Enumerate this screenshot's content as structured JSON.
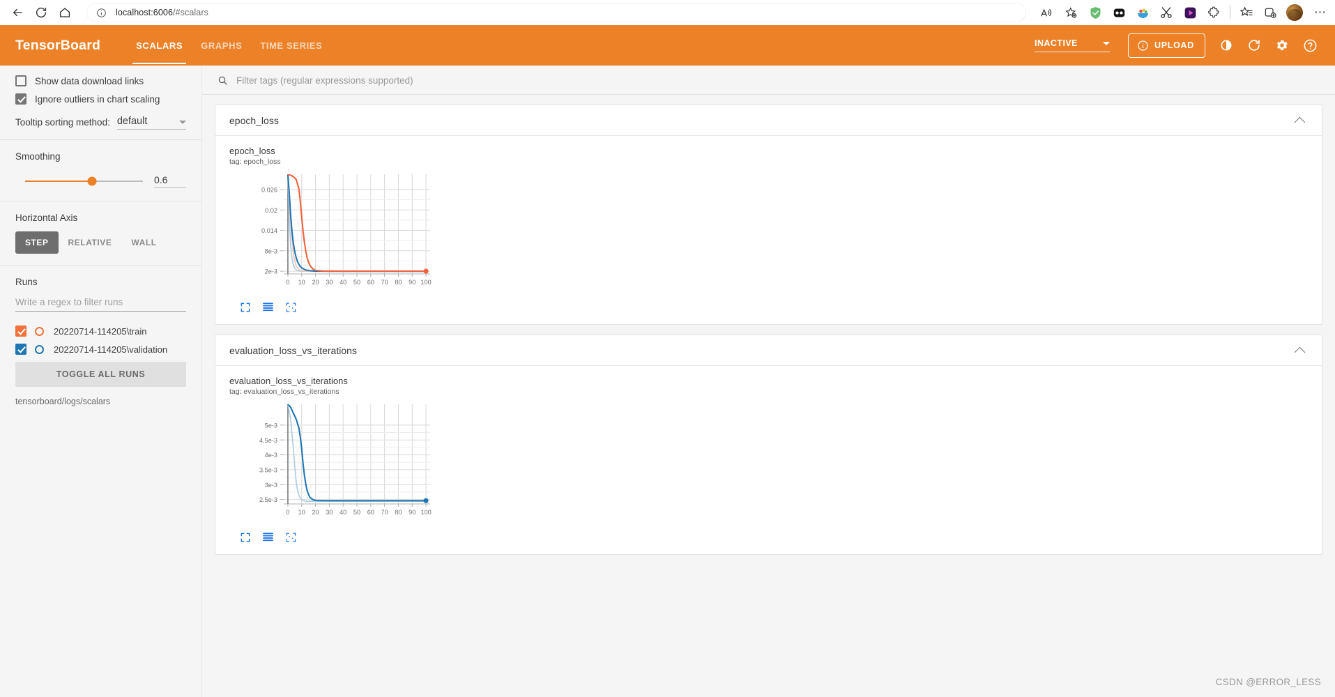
{
  "browser": {
    "back_icon": "arrow-left-icon",
    "reload_icon": "reload-icon",
    "home_icon": "home-icon",
    "url_info_icon": "info-circle-icon",
    "url_host": "localhost:6006",
    "url_path": "/#scalars",
    "read_aloud_icon": "read-aloud-icon",
    "add_favorite_icon": "favorite-star-add-icon",
    "extensions": [
      {
        "name": "adguard-shield-icon",
        "color": "#6ac46a"
      },
      {
        "name": "dark-reader-icon",
        "color": "#141414"
      },
      {
        "name": "bowl-icon",
        "color": "#3a9fd6"
      },
      {
        "name": "scissors-icon",
        "color": "#2b2b2b"
      },
      {
        "name": "media-player-icon",
        "color": "#3b1c58"
      },
      {
        "name": "puzzle-extension-icon",
        "color": "#5a5a5a"
      }
    ],
    "collections_icon": "favorites-list-icon",
    "split-screen_icon": "add-tab-group-icon",
    "avatar": "user-avatar",
    "more_icon": "more-horizontal-icon"
  },
  "header": {
    "logo": "TensorBoard",
    "tabs": [
      {
        "label": "SCALARS",
        "active": true
      },
      {
        "label": "GRAPHS",
        "active": false
      },
      {
        "label": "TIME SERIES",
        "active": false
      }
    ],
    "reload_status": "INACTIVE",
    "upload_label": "UPLOAD",
    "upload_icon": "info-circle-icon",
    "brightness_icon": "brightness-contrast-icon",
    "refresh_icon": "refresh-icon",
    "settings_icon": "gear-icon",
    "help_icon": "help-circle-icon",
    "accent_color": "#ec8127"
  },
  "sidebar": {
    "show_download_links": {
      "label": "Show data download links",
      "checked": false
    },
    "ignore_outliers": {
      "label": "Ignore outliers in chart scaling",
      "checked": true
    },
    "tooltip_sorting": {
      "label": "Tooltip sorting method:",
      "value": "default"
    },
    "smoothing": {
      "label": "Smoothing",
      "value": "0.6",
      "fraction": 0.6
    },
    "horizontal_axis": {
      "label": "Horizontal Axis",
      "options": [
        "STEP",
        "RELATIVE",
        "WALL"
      ],
      "selected": "STEP"
    },
    "runs": {
      "label": "Runs",
      "filter_placeholder": "Write a regex to filter runs",
      "items": [
        {
          "name": "20220714-114205\\train",
          "color": "#f2713a",
          "checked": true
        },
        {
          "name": "20220714-114205\\validation",
          "color": "#1f77b4",
          "checked": true
        }
      ],
      "toggle_all_label": "TOGGLE ALL RUNS",
      "logdir": "tensorboard/logs/scalars"
    }
  },
  "main": {
    "search": {
      "placeholder": "Filter tags (regular expressions supported)",
      "value": "",
      "icon": "search-icon"
    },
    "cards": [
      {
        "title": "epoch_loss",
        "collapse_icon": "chevron-up-icon",
        "chart": {
          "title": "epoch_loss",
          "tag": "tag: epoch_loss"
        },
        "tools": [
          {
            "name": "expand-chart-icon"
          },
          {
            "name": "data-table-icon"
          },
          {
            "name": "fit-domain-icon"
          }
        ]
      },
      {
        "title": "evaluation_loss_vs_iterations",
        "collapse_icon": "chevron-up-icon",
        "chart": {
          "title": "evaluation_loss_vs_iterations",
          "tag": "tag: evaluation_loss_vs_iterations"
        },
        "tools": [
          {
            "name": "expand-chart-icon"
          },
          {
            "name": "data-table-icon"
          },
          {
            "name": "fit-domain-icon"
          }
        ]
      }
    ]
  },
  "watermark": "CSDN @ERROR_LESS",
  "chart_data": [
    {
      "type": "line",
      "title": "epoch_loss",
      "tag": "tag: epoch_loss",
      "xlabel": "",
      "ylabel": "",
      "xticks": [
        0,
        10,
        20,
        30,
        40,
        50,
        60,
        70,
        80,
        90,
        100
      ],
      "yticks": [
        "2e-3",
        "8e-3",
        "0.014",
        "0.02",
        "0.026"
      ],
      "ytick_values": [
        0.002,
        0.008,
        0.014,
        0.02,
        0.026
      ],
      "xlim": [
        -3,
        103
      ],
      "ylim": [
        0.0012,
        0.0305
      ],
      "grid": true,
      "legend": "none",
      "series": [
        {
          "name": "20220714-114205\\train",
          "color": "#1f77b4",
          "smoothed": true,
          "x": [
            0,
            1,
            2,
            3,
            4,
            5,
            6,
            7,
            8,
            9,
            10,
            12,
            14,
            16,
            18,
            20,
            25,
            30,
            40,
            50,
            60,
            70,
            80,
            90,
            100
          ],
          "y": [
            0.0305,
            0.025,
            0.0185,
            0.0136,
            0.0101,
            0.0077,
            0.006,
            0.0048,
            0.004,
            0.0034,
            0.003,
            0.0025,
            0.00228,
            0.00215,
            0.00208,
            0.00204,
            0.002,
            0.00199,
            0.00198,
            0.00198,
            0.00198,
            0.00198,
            0.00198,
            0.00198,
            0.00198
          ]
        },
        {
          "name": "20220714-114205\\train (raw)",
          "color": "#aecde3",
          "smoothed": false,
          "x": [
            0,
            1,
            2,
            3,
            4,
            5,
            6,
            7,
            8,
            10,
            12,
            15,
            20,
            40,
            60,
            80,
            100
          ],
          "y": [
            0.0305,
            0.017,
            0.0096,
            0.0058,
            0.0039,
            0.0029,
            0.0024,
            0.0022,
            0.00208,
            0.002,
            0.00198,
            0.00197,
            0.00197,
            0.00197,
            0.00197,
            0.00197,
            0.00197
          ]
        },
        {
          "name": "20220714-114205\\validation",
          "color": "#f2613c",
          "smoothed": true,
          "x": [
            0,
            2,
            4,
            6,
            8,
            9,
            10,
            11,
            12,
            13,
            14,
            15,
            16,
            18,
            20,
            25,
            30,
            40,
            50,
            60,
            70,
            80,
            90,
            100
          ],
          "y": [
            0.0305,
            0.0302,
            0.0298,
            0.029,
            0.0262,
            0.0225,
            0.018,
            0.0138,
            0.0104,
            0.0078,
            0.0059,
            0.0046,
            0.0037,
            0.0027,
            0.00225,
            0.00205,
            0.00203,
            0.00202,
            0.00202,
            0.00202,
            0.00202,
            0.00202,
            0.00202,
            0.00202
          ]
        },
        {
          "name": "20220714-114205\\validation (raw)",
          "color": "#f9c4b4",
          "smoothed": false,
          "x": [
            0,
            2,
            4,
            6,
            8,
            10,
            12,
            14,
            16,
            20,
            40,
            60,
            80,
            100
          ],
          "y": [
            0.0305,
            0.016,
            0.007,
            0.0035,
            0.0024,
            0.0021,
            0.00204,
            0.00202,
            0.00202,
            0.00202,
            0.00202,
            0.00202,
            0.00202,
            0.00202
          ]
        }
      ],
      "endpoint_marker": {
        "x": 100,
        "y": 0.00202,
        "color": "#f2613c"
      }
    },
    {
      "type": "line",
      "title": "evaluation_loss_vs_iterations",
      "tag": "tag: evaluation_loss_vs_iterations",
      "xlabel": "",
      "ylabel": "",
      "xticks": [
        0,
        10,
        20,
        30,
        40,
        50,
        60,
        70,
        80,
        90,
        100
      ],
      "yticks": [
        "2.5e-3",
        "3e-3",
        "3.5e-3",
        "4e-3",
        "4.5e-3",
        "5e-3"
      ],
      "ytick_values": [
        0.0025,
        0.003,
        0.0035,
        0.004,
        0.0045,
        0.005
      ],
      "xlim": [
        -3,
        103
      ],
      "ylim": [
        0.00235,
        0.0057
      ],
      "grid": true,
      "legend": "none",
      "series": [
        {
          "name": "20220714-114205\\validation",
          "color": "#1f77b4",
          "smoothed": true,
          "x": [
            0,
            2,
            4,
            6,
            8,
            9,
            10,
            11,
            12,
            13,
            14,
            15,
            16,
            18,
            20,
            25,
            30,
            40,
            50,
            60,
            70,
            80,
            90,
            100
          ],
          "y": [
            0.0057,
            0.0056,
            0.0054,
            0.0052,
            0.0049,
            0.0046,
            0.0042,
            0.0037,
            0.0033,
            0.003,
            0.00279,
            0.00266,
            0.00257,
            0.0025,
            0.00247,
            0.00246,
            0.00246,
            0.00246,
            0.00246,
            0.00246,
            0.00246,
            0.00246,
            0.00246,
            0.00246
          ]
        },
        {
          "name": "20220714-114205\\validation (raw)",
          "color": "#aecde3",
          "smoothed": false,
          "x": [
            0,
            2,
            4,
            5,
            6,
            7,
            8,
            9,
            10,
            12,
            14,
            16,
            20,
            40,
            60,
            80,
            100
          ],
          "y": [
            0.0057,
            0.0052,
            0.0042,
            0.0036,
            0.0031,
            0.00281,
            0.00264,
            0.00254,
            0.00249,
            0.00245,
            0.00244,
            0.00244,
            0.00244,
            0.00244,
            0.00244,
            0.00244,
            0.00244
          ]
        }
      ],
      "endpoint_marker": {
        "x": 100,
        "y": 0.00246,
        "color": "#1f77b4"
      }
    }
  ]
}
